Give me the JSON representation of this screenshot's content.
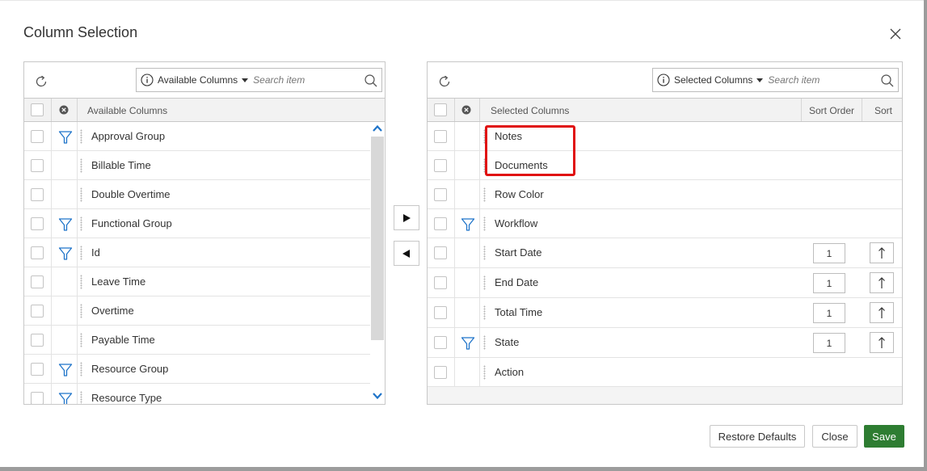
{
  "dialog": {
    "title": "Column Selection"
  },
  "left": {
    "dropdown_label": "Available Columns",
    "search_placeholder": "Search item",
    "header_label": "Available Columns",
    "rows": [
      {
        "label": "Approval Group",
        "filter": true
      },
      {
        "label": "Billable Time",
        "filter": false
      },
      {
        "label": "Double Overtime",
        "filter": false
      },
      {
        "label": "Functional Group",
        "filter": true
      },
      {
        "label": "Id",
        "filter": true
      },
      {
        "label": "Leave Time",
        "filter": false
      },
      {
        "label": "Overtime",
        "filter": false
      },
      {
        "label": "Payable Time",
        "filter": false
      },
      {
        "label": "Resource Group",
        "filter": true
      },
      {
        "label": "Resource Type",
        "filter": true
      }
    ]
  },
  "right": {
    "dropdown_label": "Selected Columns",
    "search_placeholder": "Search item",
    "header_label": "Selected Columns",
    "header_sort_order": "Sort Order",
    "header_sort": "Sort",
    "rows": [
      {
        "label": "Notes",
        "filter": false
      },
      {
        "label": "Documents",
        "filter": false
      },
      {
        "label": "Row Color",
        "filter": false
      },
      {
        "label": "Workflow",
        "filter": true
      },
      {
        "label": "Start Date",
        "filter": false,
        "sort_order": "1"
      },
      {
        "label": "End Date",
        "filter": false,
        "sort_order": "1"
      },
      {
        "label": "Total Time",
        "filter": false,
        "sort_order": "1"
      },
      {
        "label": "State",
        "filter": true,
        "sort_order": "1"
      },
      {
        "label": "Action",
        "filter": false
      }
    ]
  },
  "footer": {
    "restore_label": "Restore Defaults",
    "close_label": "Close",
    "save_label": "Save"
  },
  "colors": {
    "save_bg": "#2e7d32",
    "filter_icon": "#1f74c9",
    "highlight": "#e01010"
  }
}
